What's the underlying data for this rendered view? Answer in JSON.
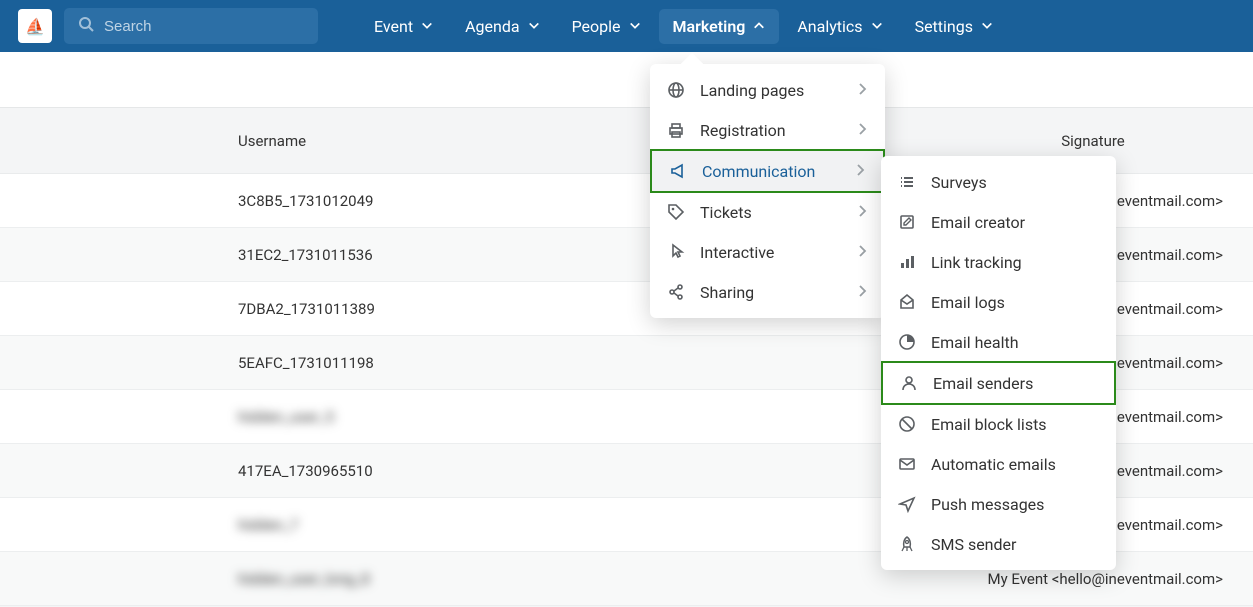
{
  "search": {
    "placeholder": "Search"
  },
  "nav": {
    "items": [
      {
        "label": "Event"
      },
      {
        "label": "Agenda"
      },
      {
        "label": "People"
      },
      {
        "label": "Marketing"
      },
      {
        "label": "Analytics"
      },
      {
        "label": "Settings"
      }
    ],
    "active_index": 3
  },
  "table": {
    "headers": {
      "username": "Username",
      "signature": "Signature"
    },
    "rows": [
      {
        "username": "3C8B5_1731012049",
        "signature": "neventmail.com>",
        "blurred": false
      },
      {
        "username": "31EC2_1731011536",
        "signature": "neventmail.com>",
        "blurred": false
      },
      {
        "username": "7DBA2_1731011389",
        "signature": "neventmail.com>",
        "blurred": false
      },
      {
        "username": "5EAFC_1731011198",
        "signature": "neventmail.com>",
        "blurred": false
      },
      {
        "username": "hidden_user_5",
        "signature": "neventmail.com>",
        "blurred": true
      },
      {
        "username": "417EA_1730965510",
        "signature": "neventmail.com>",
        "blurred": false
      },
      {
        "username": "hidden_7",
        "signature": "neventmail.com>",
        "blurred": true
      },
      {
        "username": "hidden_user_long_8",
        "signature": "My Event <hello@ineventmail.com>",
        "blurred": true
      }
    ]
  },
  "dd1": {
    "items": [
      {
        "icon": "globe",
        "label": "Landing pages",
        "arrow": true
      },
      {
        "icon": "printer",
        "label": "Registration",
        "arrow": true
      },
      {
        "icon": "bullhorn",
        "label": "Communication",
        "arrow": true,
        "highlight": true
      },
      {
        "icon": "tag",
        "label": "Tickets",
        "arrow": true
      },
      {
        "icon": "pointer",
        "label": "Interactive",
        "arrow": true
      },
      {
        "icon": "share",
        "label": "Sharing",
        "arrow": true
      }
    ]
  },
  "dd2": {
    "items": [
      {
        "icon": "list",
        "label": "Surveys"
      },
      {
        "icon": "edit",
        "label": "Email creator"
      },
      {
        "icon": "chart",
        "label": "Link tracking"
      },
      {
        "icon": "envelope-open",
        "label": "Email logs"
      },
      {
        "icon": "health",
        "label": "Email health"
      },
      {
        "icon": "user",
        "label": "Email senders",
        "box": true
      },
      {
        "icon": "ban",
        "label": "Email block lists"
      },
      {
        "icon": "envelope",
        "label": "Automatic emails"
      },
      {
        "icon": "plane",
        "label": "Push messages"
      },
      {
        "icon": "rocket",
        "label": "SMS sender"
      }
    ]
  }
}
